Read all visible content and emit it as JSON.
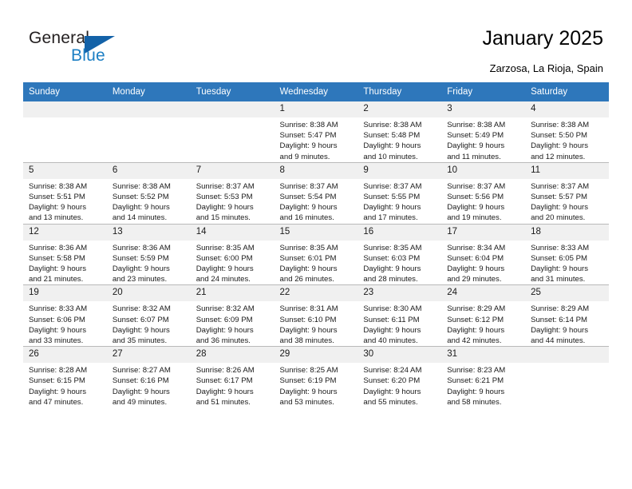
{
  "logo": {
    "word1": "General",
    "word2": "Blue",
    "triangle_color": "#1362a8",
    "blue_color": "#1c7fc4"
  },
  "header": {
    "title": "January 2025",
    "location": "Zarzosa, La Rioja, Spain",
    "accent_color": "#2e77bb"
  },
  "calendar": {
    "weekday_headers": [
      "Sunday",
      "Monday",
      "Tuesday",
      "Wednesday",
      "Thursday",
      "Friday",
      "Saturday"
    ],
    "weeks": [
      [
        {
          "day": "",
          "blank": true
        },
        {
          "day": "",
          "blank": true
        },
        {
          "day": "",
          "blank": true
        },
        {
          "day": "1",
          "sunrise": "Sunrise: 8:38 AM",
          "sunset": "Sunset: 5:47 PM",
          "daylight1": "Daylight: 9 hours",
          "daylight2": "and 9 minutes."
        },
        {
          "day": "2",
          "sunrise": "Sunrise: 8:38 AM",
          "sunset": "Sunset: 5:48 PM",
          "daylight1": "Daylight: 9 hours",
          "daylight2": "and 10 minutes."
        },
        {
          "day": "3",
          "sunrise": "Sunrise: 8:38 AM",
          "sunset": "Sunset: 5:49 PM",
          "daylight1": "Daylight: 9 hours",
          "daylight2": "and 11 minutes."
        },
        {
          "day": "4",
          "sunrise": "Sunrise: 8:38 AM",
          "sunset": "Sunset: 5:50 PM",
          "daylight1": "Daylight: 9 hours",
          "daylight2": "and 12 minutes."
        }
      ],
      [
        {
          "day": "5",
          "sunrise": "Sunrise: 8:38 AM",
          "sunset": "Sunset: 5:51 PM",
          "daylight1": "Daylight: 9 hours",
          "daylight2": "and 13 minutes."
        },
        {
          "day": "6",
          "sunrise": "Sunrise: 8:38 AM",
          "sunset": "Sunset: 5:52 PM",
          "daylight1": "Daylight: 9 hours",
          "daylight2": "and 14 minutes."
        },
        {
          "day": "7",
          "sunrise": "Sunrise: 8:37 AM",
          "sunset": "Sunset: 5:53 PM",
          "daylight1": "Daylight: 9 hours",
          "daylight2": "and 15 minutes."
        },
        {
          "day": "8",
          "sunrise": "Sunrise: 8:37 AM",
          "sunset": "Sunset: 5:54 PM",
          "daylight1": "Daylight: 9 hours",
          "daylight2": "and 16 minutes."
        },
        {
          "day": "9",
          "sunrise": "Sunrise: 8:37 AM",
          "sunset": "Sunset: 5:55 PM",
          "daylight1": "Daylight: 9 hours",
          "daylight2": "and 17 minutes."
        },
        {
          "day": "10",
          "sunrise": "Sunrise: 8:37 AM",
          "sunset": "Sunset: 5:56 PM",
          "daylight1": "Daylight: 9 hours",
          "daylight2": "and 19 minutes."
        },
        {
          "day": "11",
          "sunrise": "Sunrise: 8:37 AM",
          "sunset": "Sunset: 5:57 PM",
          "daylight1": "Daylight: 9 hours",
          "daylight2": "and 20 minutes."
        }
      ],
      [
        {
          "day": "12",
          "sunrise": "Sunrise: 8:36 AM",
          "sunset": "Sunset: 5:58 PM",
          "daylight1": "Daylight: 9 hours",
          "daylight2": "and 21 minutes."
        },
        {
          "day": "13",
          "sunrise": "Sunrise: 8:36 AM",
          "sunset": "Sunset: 5:59 PM",
          "daylight1": "Daylight: 9 hours",
          "daylight2": "and 23 minutes."
        },
        {
          "day": "14",
          "sunrise": "Sunrise: 8:35 AM",
          "sunset": "Sunset: 6:00 PM",
          "daylight1": "Daylight: 9 hours",
          "daylight2": "and 24 minutes."
        },
        {
          "day": "15",
          "sunrise": "Sunrise: 8:35 AM",
          "sunset": "Sunset: 6:01 PM",
          "daylight1": "Daylight: 9 hours",
          "daylight2": "and 26 minutes."
        },
        {
          "day": "16",
          "sunrise": "Sunrise: 8:35 AM",
          "sunset": "Sunset: 6:03 PM",
          "daylight1": "Daylight: 9 hours",
          "daylight2": "and 28 minutes."
        },
        {
          "day": "17",
          "sunrise": "Sunrise: 8:34 AM",
          "sunset": "Sunset: 6:04 PM",
          "daylight1": "Daylight: 9 hours",
          "daylight2": "and 29 minutes."
        },
        {
          "day": "18",
          "sunrise": "Sunrise: 8:33 AM",
          "sunset": "Sunset: 6:05 PM",
          "daylight1": "Daylight: 9 hours",
          "daylight2": "and 31 minutes."
        }
      ],
      [
        {
          "day": "19",
          "sunrise": "Sunrise: 8:33 AM",
          "sunset": "Sunset: 6:06 PM",
          "daylight1": "Daylight: 9 hours",
          "daylight2": "and 33 minutes."
        },
        {
          "day": "20",
          "sunrise": "Sunrise: 8:32 AM",
          "sunset": "Sunset: 6:07 PM",
          "daylight1": "Daylight: 9 hours",
          "daylight2": "and 35 minutes."
        },
        {
          "day": "21",
          "sunrise": "Sunrise: 8:32 AM",
          "sunset": "Sunset: 6:09 PM",
          "daylight1": "Daylight: 9 hours",
          "daylight2": "and 36 minutes."
        },
        {
          "day": "22",
          "sunrise": "Sunrise: 8:31 AM",
          "sunset": "Sunset: 6:10 PM",
          "daylight1": "Daylight: 9 hours",
          "daylight2": "and 38 minutes."
        },
        {
          "day": "23",
          "sunrise": "Sunrise: 8:30 AM",
          "sunset": "Sunset: 6:11 PM",
          "daylight1": "Daylight: 9 hours",
          "daylight2": "and 40 minutes."
        },
        {
          "day": "24",
          "sunrise": "Sunrise: 8:29 AM",
          "sunset": "Sunset: 6:12 PM",
          "daylight1": "Daylight: 9 hours",
          "daylight2": "and 42 minutes."
        },
        {
          "day": "25",
          "sunrise": "Sunrise: 8:29 AM",
          "sunset": "Sunset: 6:14 PM",
          "daylight1": "Daylight: 9 hours",
          "daylight2": "and 44 minutes."
        }
      ],
      [
        {
          "day": "26",
          "sunrise": "Sunrise: 8:28 AM",
          "sunset": "Sunset: 6:15 PM",
          "daylight1": "Daylight: 9 hours",
          "daylight2": "and 47 minutes."
        },
        {
          "day": "27",
          "sunrise": "Sunrise: 8:27 AM",
          "sunset": "Sunset: 6:16 PM",
          "daylight1": "Daylight: 9 hours",
          "daylight2": "and 49 minutes."
        },
        {
          "day": "28",
          "sunrise": "Sunrise: 8:26 AM",
          "sunset": "Sunset: 6:17 PM",
          "daylight1": "Daylight: 9 hours",
          "daylight2": "and 51 minutes."
        },
        {
          "day": "29",
          "sunrise": "Sunrise: 8:25 AM",
          "sunset": "Sunset: 6:19 PM",
          "daylight1": "Daylight: 9 hours",
          "daylight2": "and 53 minutes."
        },
        {
          "day": "30",
          "sunrise": "Sunrise: 8:24 AM",
          "sunset": "Sunset: 6:20 PM",
          "daylight1": "Daylight: 9 hours",
          "daylight2": "and 55 minutes."
        },
        {
          "day": "31",
          "sunrise": "Sunrise: 8:23 AM",
          "sunset": "Sunset: 6:21 PM",
          "daylight1": "Daylight: 9 hours",
          "daylight2": "and 58 minutes."
        },
        {
          "day": "",
          "blank": true
        }
      ]
    ]
  }
}
